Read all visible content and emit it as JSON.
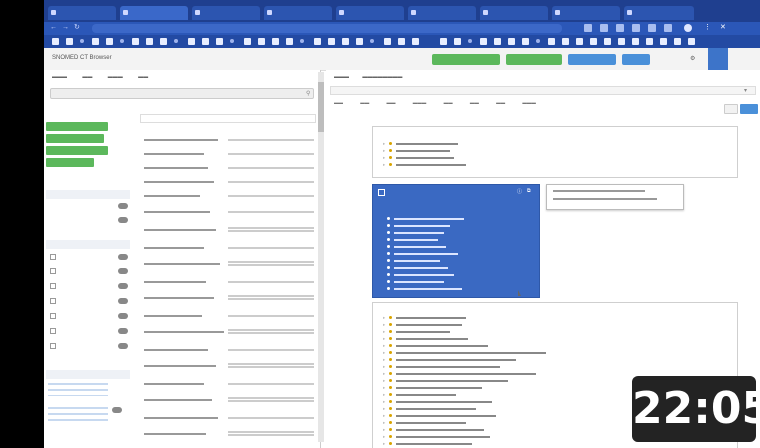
{
  "badge": {
    "time": "22:05"
  },
  "app": {
    "title": "SNOMED CT Browser"
  },
  "header_buttons": {
    "green1": "",
    "green2": "",
    "blue1": "",
    "blue2": "",
    "user": ""
  },
  "left": {
    "search_placeholder": "",
    "col_options": "",
    "col_results": "",
    "filters": [],
    "links": []
  },
  "right": {
    "card1_title": "",
    "card3_title": "",
    "blue_header": "",
    "blue_subtitle": "",
    "blue_section": ""
  },
  "colors": {
    "chrome_blue": "#1f3f8f",
    "accent_green": "#5cb85c",
    "accent_blue": "#4a90d9",
    "concept_card": "#3a69c2"
  }
}
